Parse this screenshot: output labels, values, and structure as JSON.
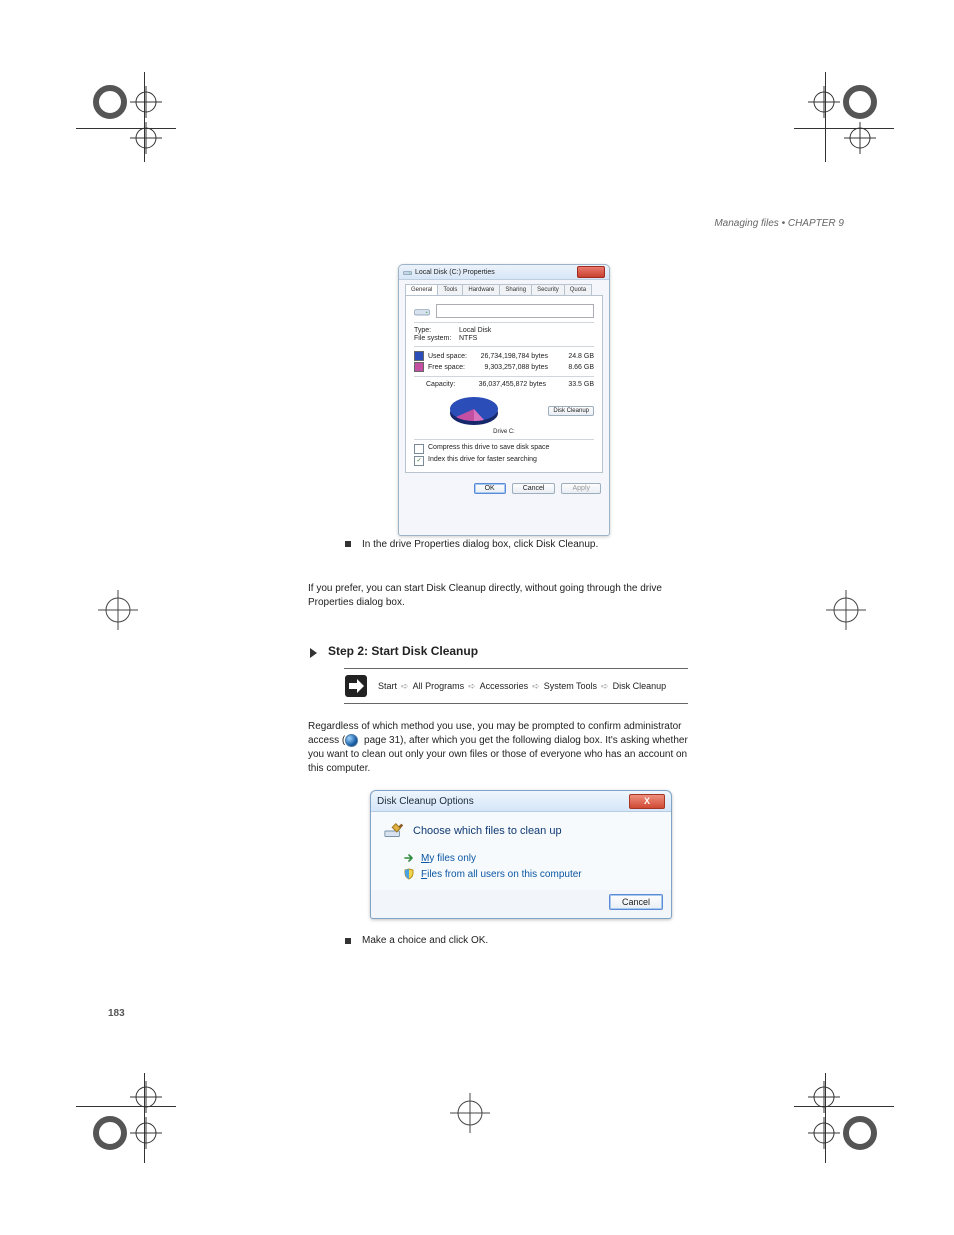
{
  "header": {
    "running": "Managing files  •  CHAPTER 9"
  },
  "propWin": {
    "title": "Local Disk (C:) Properties",
    "tabs": [
      "General",
      "Tools",
      "Hardware",
      "Sharing",
      "Security",
      "Quota"
    ],
    "typeLabel": "Type:",
    "typeValue": "Local Disk",
    "fsLabel": "File system:",
    "fsValue": "NTFS",
    "usedLabel": "Used space:",
    "usedBytes": "26,734,198,784 bytes",
    "usedGb": "24.8 GB",
    "freeLabel": "Free space:",
    "freeBytes": "9,303,257,088 bytes",
    "freeGb": "8.66 GB",
    "capLabel": "Capacity:",
    "capBytes": "36,037,455,872 bytes",
    "capGb": "33.5 GB",
    "driveLabel": "Drive C:",
    "diskCleanup": "Disk Cleanup",
    "compress": "Compress this drive to save disk space",
    "index": "Index this drive for faster searching",
    "ok": "OK",
    "cancel": "Cancel",
    "apply": "Apply"
  },
  "chart_data": {
    "type": "pie",
    "title": "Drive C:",
    "series": [
      {
        "name": "Used space",
        "valueBytes": 26734198784,
        "valueGb": 24.8,
        "color": "#2a4db7"
      },
      {
        "name": "Free space",
        "valueBytes": 9303257088,
        "valueGb": 8.66,
        "color": "#c24fa1"
      }
    ],
    "totalBytes": 36037455872,
    "totalGb": 33.5
  },
  "body": {
    "cap1": "In the drive Properties dialog box, click Disk Cleanup.",
    "lead": "If you prefer, you can start Disk Cleanup directly, without going through the drive Properties dialog box.",
    "step2": "Step 2: Start Disk Cleanup",
    "sc": {
      "p1": "Start",
      "p2": "All Programs",
      "p3": "Accessories",
      "p4": "System Tools",
      "p5": "Disk Cleanup"
    },
    "afterSc1": "Regardless of which method you use, you may be prompted to confirm administrator access (",
    "afterSc2": " page 31), after which you get the following dialog box. It's asking whether you want to clean out only your own files or those of everyone who has an account on this computer.",
    "cap2": "Make a choice and click OK."
  },
  "cleanWin": {
    "title": "Disk Cleanup Options",
    "heading": "Choose which files to clean up",
    "opt1": "My files only",
    "opt1_u": "M",
    "opt2": "Files from all users on this computer",
    "opt2_u": "F",
    "cancel": "Cancel"
  },
  "pageNumber": "183"
}
